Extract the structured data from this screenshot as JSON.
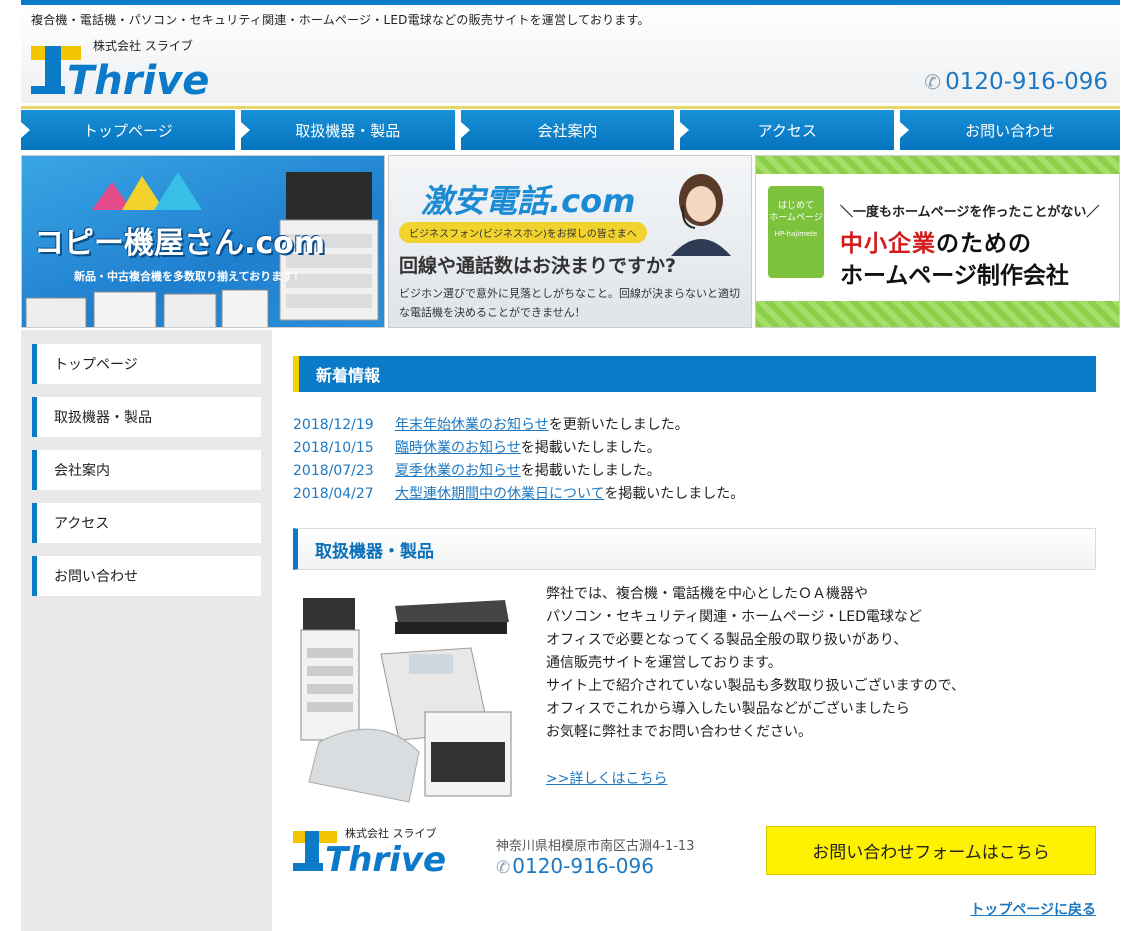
{
  "header": {
    "tagline": "複合機・電話機・パソコン・セキュリティ関連・ホームページ・LED電球などの販売サイトを運営しております。",
    "company_small": "株式会社 スライブ",
    "logo_text": "Thrive",
    "phone": "0120-916-096"
  },
  "nav": {
    "items": [
      {
        "label": "トップページ"
      },
      {
        "label": "取扱機器・製品"
      },
      {
        "label": "会社案内"
      },
      {
        "label": "アクセス"
      },
      {
        "label": "お問い合わせ"
      }
    ]
  },
  "banners": {
    "copy": {
      "title": "コピー機屋さん.com",
      "sub": "新品・中古複合機を多数取り揃えております！"
    },
    "phone": {
      "title": "激安電話.com",
      "pill": "ビジネスフォン(ビジネスホン)をお探しの皆さまへ",
      "question": "回線や通話数はお決まりですか?",
      "desc": "ビジホン選びで意外に見落としがちなこと。回線が決まらないと適切な電話機を決めることができません！"
    },
    "web": {
      "badge_1": "はじめて",
      "badge_2": "ホームページ",
      "badge_3": "HP-hajimete",
      "top": "＼一度もホームページを作ったことがない／",
      "line1_red": "中小企業",
      "line1_rest": "のための",
      "line2": "ホームページ制作会社"
    }
  },
  "sidebar": {
    "items": [
      {
        "label": "トップページ"
      },
      {
        "label": "取扱機器・製品"
      },
      {
        "label": "会社案内"
      },
      {
        "label": "アクセス"
      },
      {
        "label": "お問い合わせ"
      }
    ]
  },
  "news": {
    "heading": "新着情報",
    "items": [
      {
        "date": "2018/12/19",
        "link": "年末年始休業のお知らせ",
        "suffix": "を更新いたしました。"
      },
      {
        "date": "2018/10/15",
        "link": "臨時休業のお知らせ",
        "suffix": "を掲載いたしました。"
      },
      {
        "date": "2018/07/23",
        "link": "夏季休業のお知らせ",
        "suffix": "を掲載いたしました。"
      },
      {
        "date": "2018/04/27",
        "link": "大型連休期間中の休業日について",
        "suffix": "を掲載いたしました。"
      }
    ]
  },
  "products": {
    "heading": "取扱機器・製品",
    "lines": [
      "弊社では、複合機・電話機を中心としたＯＡ機器や",
      "パソコン・セキュリティ関連・ホームページ・LED電球など",
      "オフィスで必要となってくる製品全般の取り扱いがあり、",
      "通信販売サイトを運営しております。",
      "サイト上で紹介されていない製品も多数取り扱いございますので、",
      "オフィスでこれから導入したい製品などがございましたら",
      "お気軽に弊社までお問い合わせください。"
    ],
    "more": ">>詳しくはこちら"
  },
  "footer": {
    "company_small": "株式会社 スライブ",
    "logo_text": "Thrive",
    "address": "神奈川県相模原市南区古淵4-1-13",
    "phone": "0120-916-096",
    "form_button": "お問い合わせフォームはこちら",
    "back_to_top": "トップページに戻る"
  },
  "colors": {
    "brand_blue": "#0a7ac9",
    "accent_yellow": "#f2d200",
    "button_yellow": "#fff200",
    "link_blue": "#1d78c1"
  }
}
